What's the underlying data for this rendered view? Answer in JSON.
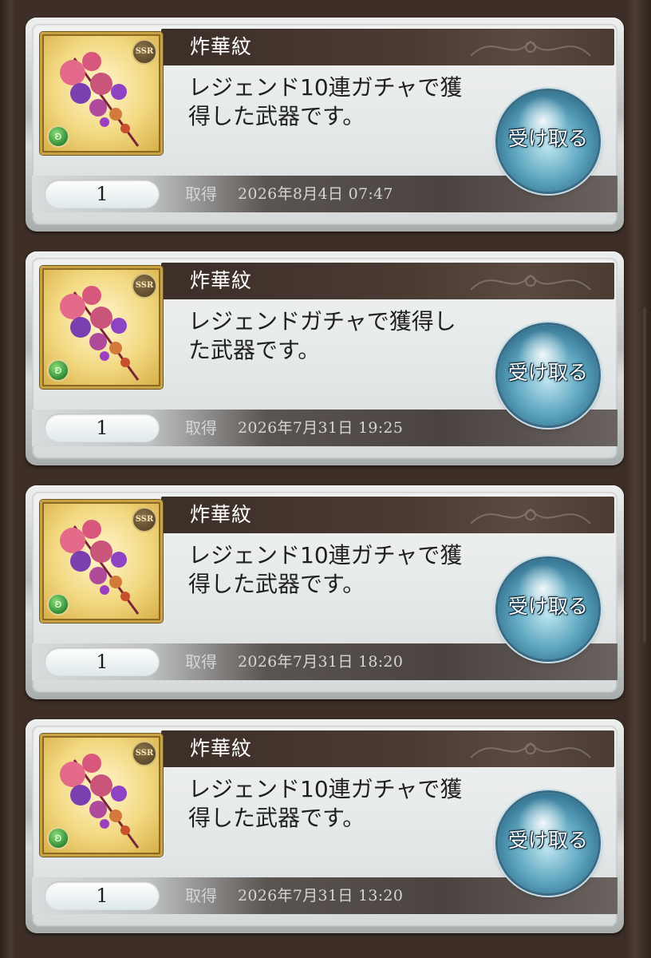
{
  "items": [
    {
      "name": "炸華紋",
      "rarity": "SSR",
      "description_line1": "レジェンド10連ガチャで獲",
      "description_line2": "得した武器です。",
      "quantity": "1",
      "obtained_label": "取得",
      "obtained_date": "2026年8月4日 07:47",
      "button_label": "受け取る"
    },
    {
      "name": "炸華紋",
      "rarity": "SSR",
      "description_line1": "レジェンドガチャで獲得し",
      "description_line2": "た武器です。",
      "quantity": "1",
      "obtained_label": "取得",
      "obtained_date": "2026年7月31日 19:25",
      "button_label": "受け取る"
    },
    {
      "name": "炸華紋",
      "rarity": "SSR",
      "description_line1": "レジェンド10連ガチャで獲",
      "description_line2": "得した武器です。",
      "quantity": "1",
      "obtained_label": "取得",
      "obtained_date": "2026年7月31日 18:20",
      "button_label": "受け取る"
    },
    {
      "name": "炸華紋",
      "rarity": "SSR",
      "description_line1": "レジェンド10連ガチャで獲",
      "description_line2": "得した武器です。",
      "quantity": "1",
      "obtained_label": "取得",
      "obtained_date": "2026年7月31日 13:20",
      "button_label": "受け取る"
    }
  ],
  "icons": {
    "weapon_image": "weapon-thumbnail-icon",
    "rarity_badge": "ssr-badge-icon",
    "element_badge": "wind-element-icon"
  },
  "colors": {
    "title_bar": "#3c2f28",
    "button_blue": "#5fa7c0",
    "frame_gold": "#c9a343",
    "element_green": "#2f8a36"
  }
}
